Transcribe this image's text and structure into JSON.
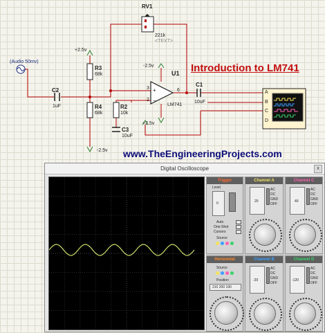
{
  "schematic": {
    "title": "Introduction to LM741",
    "website": "www.TheEngineeringProjects.com",
    "source_label": "(Audio 50mv)",
    "components": {
      "rv1": {
        "name": "RV1",
        "value": "221k",
        "note": "<TEXT>"
      },
      "r3": {
        "name": "R3",
        "value": "68k"
      },
      "r4": {
        "name": "R4",
        "value": "68k"
      },
      "r2": {
        "name": "R2",
        "value": "10k"
      },
      "c2": {
        "name": "C2",
        "value": "1uF"
      },
      "c3": {
        "name": "C3",
        "value": "10uF"
      },
      "c1": {
        "name": "C1",
        "value": "10uF"
      },
      "u1": {
        "name": "U1",
        "part": "LM741",
        "pin_in": "3",
        "pin_fb": "2",
        "pin_out": "6"
      }
    },
    "supplies": {
      "pos_top": "+2.5v",
      "neg_op": "-2.5v",
      "pos_op": "+2.5v",
      "neg_bottom": "-2.5v"
    },
    "scope_channels": [
      "A",
      "B",
      "C",
      "D"
    ]
  },
  "oscilloscope": {
    "title": "Digital Oscilloscope",
    "close": "x",
    "channels": {
      "a": {
        "name": "Channel A",
        "color": "#f2e35e",
        "position": "20",
        "ac": "AC",
        "dc": "DC",
        "gnd": "GND",
        "off": "OFF"
      },
      "b": {
        "name": "Channel B",
        "color": "#3aa0ff",
        "position": "-20",
        "ac": "AC",
        "dc": "DC",
        "gnd": "GND",
        "off": "OFF"
      },
      "c": {
        "name": "Channel C",
        "color": "#ff5fb0",
        "position": "40",
        "ac": "AC",
        "dc": "DC",
        "gnd": "GND",
        "off": "OFF"
      },
      "d": {
        "name": "Channel D",
        "color": "#39d46a",
        "position": "-120",
        "ac": "AC",
        "dc": "DC",
        "gnd": "GND",
        "off": "OFF"
      }
    },
    "trigger": {
      "name": "Trigger",
      "color": "#ff6a2e",
      "level_label": "Level",
      "level_value": "0",
      "auto": "Auto",
      "one_shot": "One-Shot",
      "cursors": "Cursors",
      "source": "Source"
    },
    "horizontal": {
      "name": "Horizontal",
      "color": "#ff8a2e",
      "source": "Source",
      "position": "Position",
      "readout": "210  200  190"
    },
    "trace_color": "#cde06a"
  }
}
